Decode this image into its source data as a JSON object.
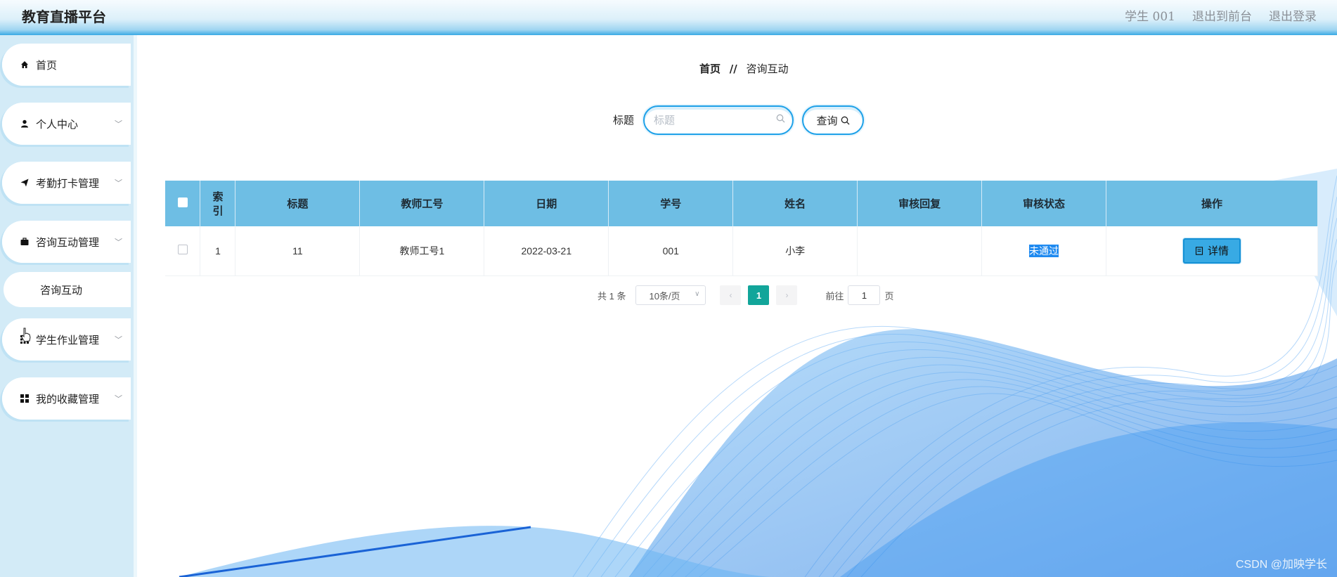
{
  "header": {
    "title": "教育直播平台",
    "user": "学生 001",
    "front_link": "退出到前台",
    "logout": "退出登录"
  },
  "sidebar": {
    "items": [
      {
        "label": "首页",
        "icon": "home-icon"
      },
      {
        "label": "个人中心",
        "icon": "user-icon"
      },
      {
        "label": "考勤打卡管理",
        "icon": "send-icon"
      },
      {
        "label": "咨询互动管理",
        "icon": "briefcase-icon"
      },
      {
        "label": "咨询互动",
        "icon": ""
      },
      {
        "label": "学生作业管理",
        "icon": "grid-icon"
      },
      {
        "label": "我的收藏管理",
        "icon": "apps-icon"
      }
    ]
  },
  "breadcrumb": {
    "home": "首页",
    "separator": "//",
    "current": "咨询互动"
  },
  "search": {
    "label": "标题",
    "placeholder": "标题",
    "button": "查询"
  },
  "table": {
    "headers": [
      "索引",
      "标题",
      "教师工号",
      "日期",
      "学号",
      "姓名",
      "审核回复",
      "审核状态",
      "操作"
    ],
    "index_header_line1": "索",
    "index_header_line2": "引",
    "rows": [
      {
        "index": "1",
        "title": "11",
        "teacher_id": "教师工号1",
        "date": "2022-03-21",
        "student_id": "001",
        "name": "小李",
        "reply": "",
        "status": "未通过",
        "action": "详情"
      }
    ]
  },
  "pagination": {
    "total": "共 1 条",
    "page_size": "10条/页",
    "current_page": "1",
    "goto_prefix": "前往",
    "goto_value": "1",
    "goto_suffix": "页"
  },
  "watermark": "CSDN @加映学长",
  "colors": {
    "accent": "#1ea1e8",
    "table_header": "#6ebee4",
    "page_active": "#12a59a",
    "sidebar_bg": "#d3ebf7"
  }
}
